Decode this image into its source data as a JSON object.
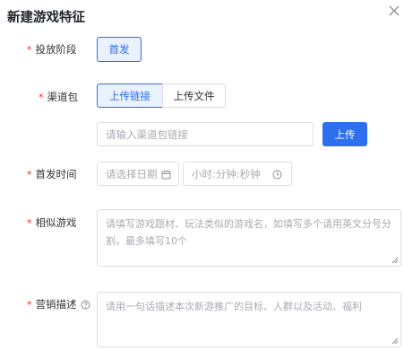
{
  "dialog": {
    "title": "新建游戏特征",
    "close_icon": "close-icon"
  },
  "form": {
    "launch_stage": {
      "label": "投放阶段",
      "option": "首发"
    },
    "channel_package": {
      "label": "渠道包",
      "tabs": [
        "上传链接",
        "上传文件"
      ],
      "selected_tab": "上传链接",
      "link_placeholder": "请输入渠道包链接",
      "upload_button": "上传"
    },
    "launch_time": {
      "label": "首发时间",
      "date_placeholder": "请选择日期",
      "time_placeholder": "小时:分钟:秒钟"
    },
    "similar_games": {
      "label": "相似游戏",
      "placeholder": "请填写游戏题材、玩法类似的游戏名，如填写多个请用英文分号分割，最多填写10个"
    },
    "marketing_desc": {
      "label": "营销描述",
      "info_icon": "help-circle-icon",
      "placeholder": "请用一句话描述本次新游推广的目标、人群以及活动、福利"
    }
  },
  "colors": {
    "accent": "#2d6fef",
    "required": "#f5222d",
    "placeholder": "#a8abb2"
  }
}
